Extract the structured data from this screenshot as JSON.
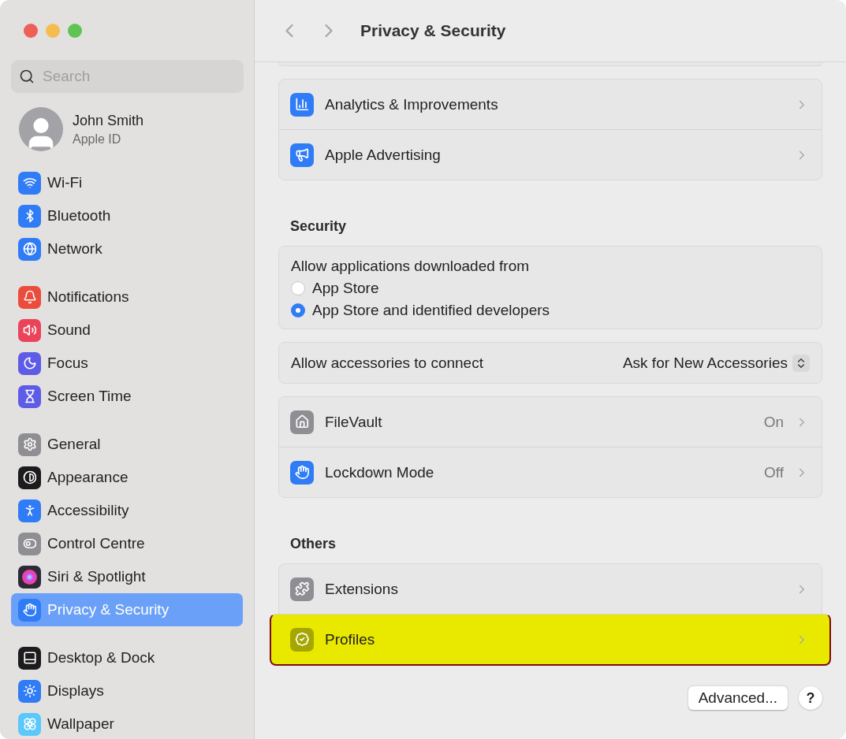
{
  "window": {
    "title": "Privacy & Security"
  },
  "sidebar": {
    "search": {
      "placeholder": "Search"
    },
    "account": {
      "name": "John Smith",
      "subtitle": "Apple ID"
    },
    "groups": [
      {
        "items": [
          {
            "label": "Wi-Fi",
            "kind": "wifi",
            "color": "#2f7cf6",
            "selected": false
          },
          {
            "label": "Bluetooth",
            "kind": "bluetooth",
            "color": "#2f7cf6",
            "selected": false
          },
          {
            "label": "Network",
            "kind": "globe",
            "color": "#2f7cf6",
            "selected": false
          }
        ]
      },
      {
        "items": [
          {
            "label": "Notifications",
            "kind": "bell",
            "color": "#eb4d3d",
            "selected": false
          },
          {
            "label": "Sound",
            "kind": "speaker",
            "color": "#eb445a",
            "selected": false
          },
          {
            "label": "Focus",
            "kind": "moon",
            "color": "#5e5ce6",
            "selected": false
          },
          {
            "label": "Screen Time",
            "kind": "hourglass",
            "color": "#5e5ce6",
            "selected": false
          }
        ]
      },
      {
        "items": [
          {
            "label": "General",
            "kind": "gear",
            "color": "#8e8e93",
            "selected": false
          },
          {
            "label": "Appearance",
            "kind": "contrast",
            "color": "#1c1c1e",
            "selected": false
          },
          {
            "label": "Accessibility",
            "kind": "accessibility",
            "color": "#2f7cf6",
            "selected": false
          },
          {
            "label": "Control Centre",
            "kind": "toggles",
            "color": "#8e8e93",
            "selected": false
          },
          {
            "label": "Siri & Spotlight",
            "kind": "orb",
            "color": "#2a2a3a",
            "selected": false
          },
          {
            "label": "Privacy & Security",
            "kind": "hand",
            "color": "#2f7cf6",
            "selected": true
          }
        ]
      },
      {
        "items": [
          {
            "label": "Desktop & Dock",
            "kind": "dock",
            "color": "#1c1c1e",
            "selected": false
          },
          {
            "label": "Displays",
            "kind": "sun",
            "color": "#2f7cf6",
            "selected": false
          },
          {
            "label": "Wallpaper",
            "kind": "flower",
            "color": "#5ac8fa",
            "selected": false
          }
        ]
      }
    ]
  },
  "main": {
    "sections": [
      {
        "cards": [
          {
            "kind": "rows",
            "rows": [
              {
                "label": "Analytics & Improvements",
                "kind": "chart",
                "color": "#2f7cf6",
                "highlighted": false
              },
              {
                "label": "Apple Advertising",
                "kind": "megaphone",
                "color": "#2f7cf6",
                "highlighted": false
              }
            ]
          }
        ]
      },
      {
        "heading": "Security",
        "cards": [
          {
            "kind": "radio",
            "title": "Allow applications downloaded from",
            "options": [
              {
                "label": "App Store",
                "selected": false
              },
              {
                "label": "App Store and identified developers",
                "selected": true
              }
            ]
          },
          {
            "kind": "popup",
            "label": "Allow accessories to connect",
            "value": "Ask for New Accessories"
          },
          {
            "kind": "rows",
            "rows": [
              {
                "label": "FileVault",
                "kind": "house",
                "color": "#8e8e93",
                "value": "On",
                "highlighted": false
              },
              {
                "label": "Lockdown Mode",
                "kind": "hand",
                "color": "#2f7cf6",
                "value": "Off",
                "highlighted": false
              }
            ]
          }
        ]
      },
      {
        "heading": "Others",
        "cards": [
          {
            "kind": "rows",
            "rows": [
              {
                "label": "Extensions",
                "kind": "puzzle",
                "color": "#8e8e93",
                "highlighted": false
              },
              {
                "label": "Profiles",
                "kind": "badge",
                "color": "#a6a600",
                "highlighted": true
              }
            ]
          }
        ]
      }
    ],
    "footer": {
      "button": "Advanced...",
      "help": "?"
    }
  }
}
